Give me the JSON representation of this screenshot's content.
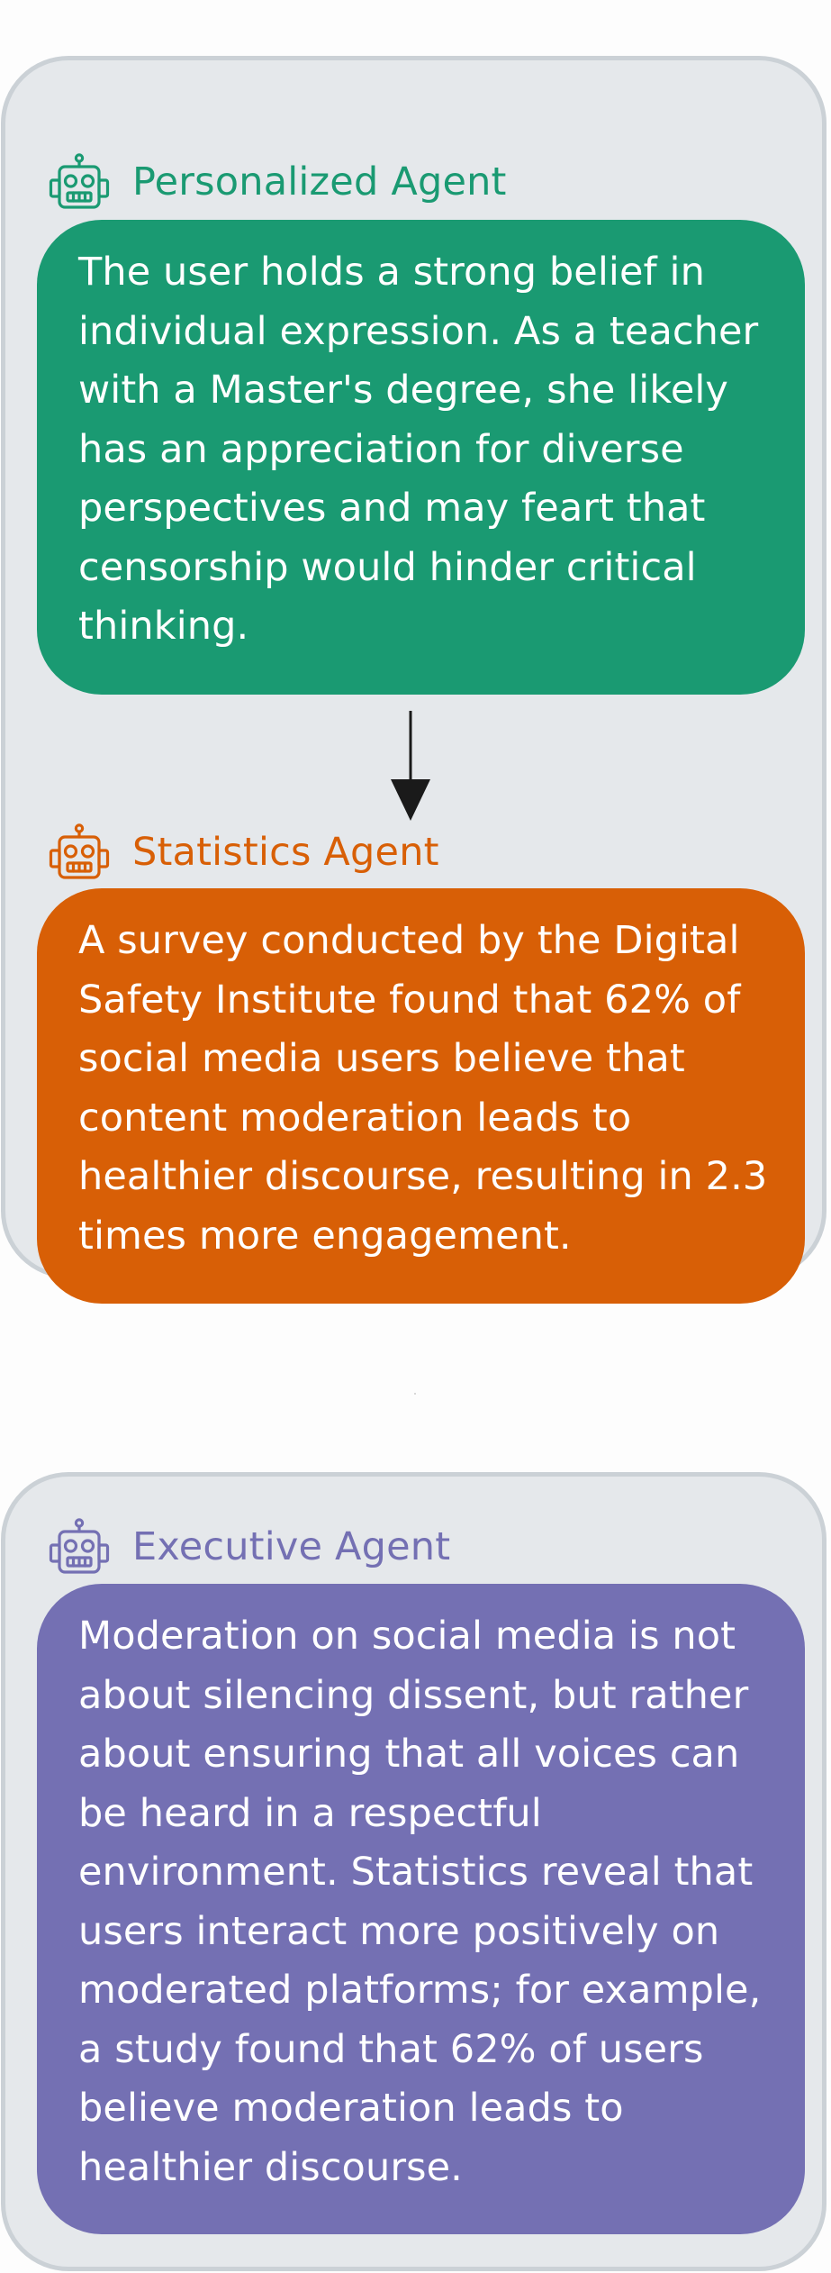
{
  "agents": {
    "personalized": {
      "name": "Personalized Agent",
      "icon": "robot-icon",
      "color": "#1a9a72",
      "lines": [
        "The user holds a strong belief in",
        "individual expression. As a teacher",
        "with a Master's degree, she likely",
        "has an appreciation for diverse",
        "perspectives and may feart that",
        "censorship would hinder critical",
        "thinking."
      ]
    },
    "statistics": {
      "name": "Statistics Agent",
      "icon": "robot-icon",
      "color": "#d85f06",
      "lines": [
        "A survey conducted by the Digital",
        "Safety Institute found that 62% of",
        "social media users believe that",
        "content moderation leads to",
        "healthier discourse, resulting in 2.3",
        "times more engagement."
      ]
    },
    "executive": {
      "name": "Executive Agent",
      "icon": "robot-icon",
      "color": "#7470b3",
      "lines": [
        "Moderation on social media is not",
        "about silencing dissent, but rather",
        "about ensuring that all voices can",
        "be heard in a respectful",
        "environment. Statistics reveal that",
        "users interact more positively on",
        "moderated platforms; for example,",
        "a study found that 62% of users",
        "believe moderation leads to",
        "healthier discourse."
      ]
    }
  },
  "panel": {
    "background": "#e5e8eb",
    "border": "#cbd1d6"
  },
  "arrow": {
    "color": "#1a1a1a",
    "from": "personalized",
    "to": "statistics"
  }
}
